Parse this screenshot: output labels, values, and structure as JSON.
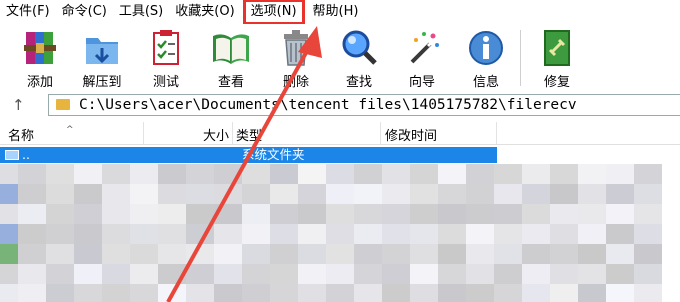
{
  "menu": {
    "items": [
      "文件(F)",
      "命令(C)",
      "工具(S)",
      "收藏夹(O)",
      "选项(N)",
      "帮助(H)"
    ]
  },
  "toolbar": {
    "buttons": [
      {
        "label": "添加",
        "icon": "archive-add-icon"
      },
      {
        "label": "解压到",
        "icon": "extract-folder-icon"
      },
      {
        "label": "测试",
        "icon": "test-checklist-icon"
      },
      {
        "label": "查看",
        "icon": "view-book-icon"
      },
      {
        "label": "删除",
        "icon": "delete-trash-icon"
      },
      {
        "label": "查找",
        "icon": "find-magnifier-icon"
      },
      {
        "label": "向导",
        "icon": "wizard-wand-icon"
      },
      {
        "label": "信息",
        "icon": "info-icon"
      },
      {
        "label": "修复",
        "icon": "repair-book-icon"
      }
    ]
  },
  "address": {
    "path": "C:\\Users\\acer\\Documents\\tencent files\\1405175782\\filerecv"
  },
  "columns": {
    "name": "名称",
    "size": "大小",
    "type": "类型",
    "modified": "修改时间"
  },
  "rows": [
    {
      "name": "..",
      "type": "系统文件夹"
    }
  ],
  "colors": {
    "highlight_box": "#e8322b",
    "annotation_arrow": "#e8463a",
    "selected_row": "#1c86e8"
  }
}
